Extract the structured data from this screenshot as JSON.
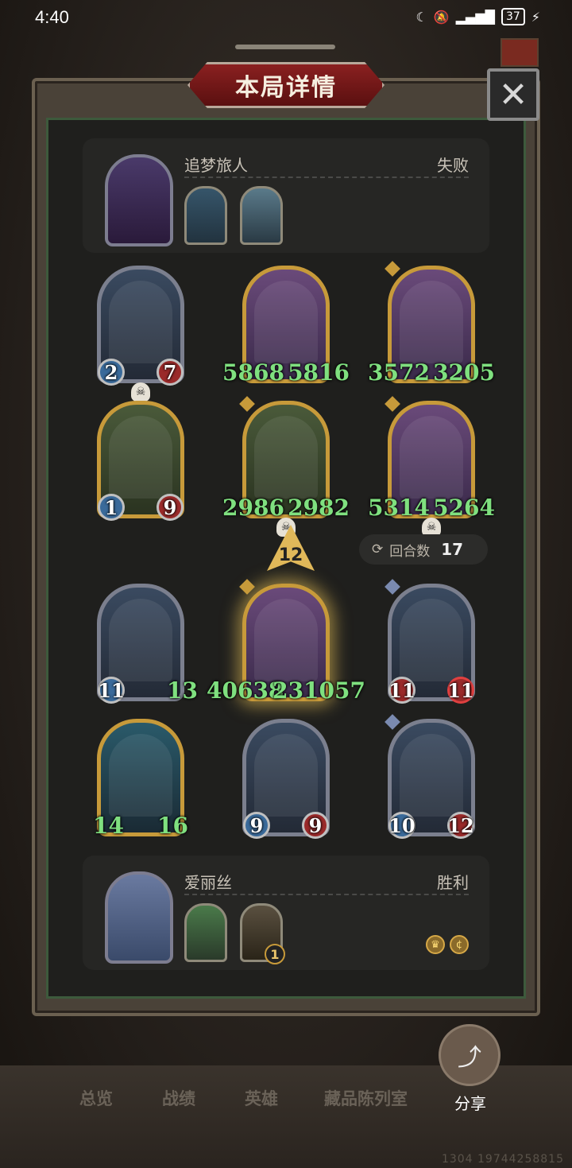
{
  "status_bar": {
    "time": "4:40",
    "icons": [
      "moon-icon",
      "bell-off-icon",
      "4g-signal-icon"
    ],
    "battery": "37"
  },
  "dialog": {
    "title": "本局详情",
    "close": "✕"
  },
  "opponent": {
    "name": "追梦旅人",
    "result": "失败"
  },
  "opponent_board": [
    {
      "name": "minion-1",
      "atk": "2",
      "hp": "7",
      "dead": true
    },
    {
      "name": "minion-2",
      "atk": "5868",
      "hp": "5816",
      "dead": false
    },
    {
      "name": "minion-3",
      "atk": "3572",
      "hp": "3205",
      "dead": false
    },
    {
      "name": "minion-4",
      "atk": "1",
      "hp": "9",
      "dead": false
    },
    {
      "name": "minion-5",
      "atk": "2986",
      "hp": "2982",
      "dead": true
    },
    {
      "name": "minion-6",
      "atk": "5314",
      "hp": "5264",
      "dead": true
    }
  ],
  "tier": "12",
  "rounds": {
    "label": "回合数",
    "value": "17"
  },
  "player_board": [
    {
      "name": "minion-7",
      "atk": "11",
      "hp": "13"
    },
    {
      "name": "minion-8",
      "atk": "40638",
      "hp": "231057"
    },
    {
      "name": "minion-9",
      "atk": "11",
      "hp": "11"
    },
    {
      "name": "minion-10",
      "atk": "14",
      "hp": "16"
    },
    {
      "name": "minion-11",
      "atk": "9",
      "hp": "9"
    },
    {
      "name": "minion-12",
      "atk": "10",
      "hp": "12"
    }
  ],
  "player": {
    "name": "爱丽丝",
    "result": "胜利",
    "hero_power_badge": "1"
  },
  "nav": {
    "items": [
      "总览",
      "战绩",
      "英雄",
      "藏品陈列室"
    ],
    "share": "分享"
  },
  "footer_id": "1304 19744258815",
  "colors": {
    "accent_red": "#8a2020",
    "gold": "#c79a3a",
    "stat_green": "#7fe07f"
  }
}
